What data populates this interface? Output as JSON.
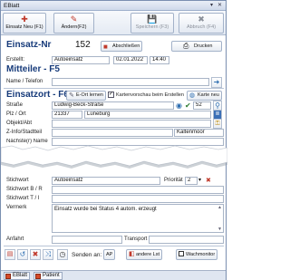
{
  "titlebar": {
    "title": "EBlatt",
    "controls": "▾ ✕"
  },
  "toolbar": {
    "new": {
      "icon": "✚",
      "label": "Einsatz Neu (F1)"
    },
    "change": {
      "icon": "✎",
      "label": "Ändern(F2)"
    },
    "save": {
      "icon": "💾",
      "label": "Speichern (F3)"
    },
    "cancel": {
      "icon": "✖",
      "label": "Abbruch (F4)"
    }
  },
  "einsatz": {
    "title": "Einsatz-Nr",
    "number": "152",
    "close_button": "Abschließen",
    "print_button": "Drucken",
    "created_label": "Erstellt:",
    "created_by": "Autoeinsatz",
    "created_date": "02.01.2022",
    "created_time": "14:40"
  },
  "mitteiler": {
    "title": "Mitteiler  -  F5",
    "name_label": "Name / Telefon",
    "name_value": ""
  },
  "einsatzort": {
    "title": "Einsatzort - F6",
    "edit_button": "E-Ort lernen",
    "map_checkbox_label": "Kartenvorschau beim Erstellen",
    "map_button": "Karte neu",
    "street_label": "Straße",
    "street_value": "Ludwig-Beck-Straße",
    "house_number": "52",
    "plz_label": "Plz / Ort",
    "plz_value": "21337",
    "city_value": "Lüneburg",
    "object_label": "Objekt/Abt",
    "z_info_label": "Z-Info/Stadtteil",
    "z_info_value": "Kaltenmoor",
    "next_label": "Nächste(r) Name"
  },
  "stichworte": {
    "label1": "Stichwort",
    "value1": "Autoeinsatz",
    "prio_label": "Priorität",
    "prio_value": "2",
    "label2": "Stichwort B / R",
    "label3": "Stichwort T / I"
  },
  "vermerk": {
    "label": "Vermerk",
    "text": "Einsatz wurde bei Status 4 autom. erzeugt"
  },
  "bottom": {
    "anfahrt_label": "Anfahrt",
    "transport_label": "Transport",
    "send_label": "Senden an:",
    "ap_button": "AP",
    "other_button": "andere Lst",
    "wach_button": "Wachmonitor"
  },
  "tabs": [
    "EBlatt",
    "Patient"
  ]
}
